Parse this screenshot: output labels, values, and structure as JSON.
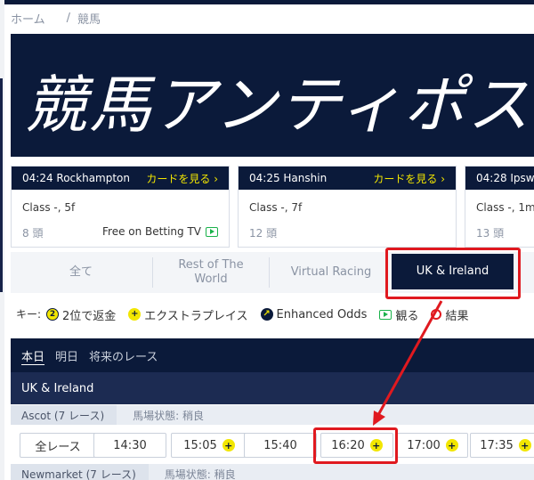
{
  "breadcrumb": {
    "home": "ホーム",
    "separator": "/",
    "current": "競馬"
  },
  "hero": {
    "title": "競馬アンティポスト"
  },
  "cards": [
    {
      "time_venue": "04:24 Rockhampton",
      "link": "カードを見る ›",
      "class": "Class -, 5f",
      "runners": "8 頭",
      "betting_tv": "Free on Betting TV"
    },
    {
      "time_venue": "04:25 Hanshin",
      "link": "カードを見る ›",
      "class": "Class -, 7f",
      "runners": "12 頭"
    },
    {
      "time_venue": "04:28 Ipsw",
      "class": "Class -, 1m",
      "runners": "13 頭"
    }
  ],
  "tabs": [
    {
      "label": "全て"
    },
    {
      "label": "Rest of The World"
    },
    {
      "label": "Virtual Racing"
    },
    {
      "label": "UK & Ireland"
    }
  ],
  "key": {
    "label": "キー:",
    "items": [
      {
        "icon": "2",
        "text": "2位で返金"
      },
      {
        "icon": "+",
        "text": "エクストラプレイス"
      },
      {
        "icon": "odds",
        "text": "Enhanced Odds"
      },
      {
        "icon": "tv",
        "text": "観る"
      },
      {
        "icon": "result",
        "text": "結果"
      }
    ]
  },
  "days": [
    "本日",
    "明日",
    "将来のレース"
  ],
  "region": "UK & Ireland",
  "meetings": [
    {
      "name": "Ascot (7 レース)",
      "going": "馬場状態: 稍良"
    },
    {
      "name": "Newmarket (7 レース)",
      "going": "馬場状態: 稍良"
    }
  ],
  "times": [
    {
      "label": "全レース"
    },
    {
      "label": "14:30"
    },
    {
      "label": "15:05"
    },
    {
      "label": "15:40"
    },
    {
      "label": "16:20"
    },
    {
      "label": "17:00"
    },
    {
      "label": "17:35"
    }
  ],
  "colors": {
    "navy": "#0b1a3a",
    "yellow": "#f2e600",
    "highlight": "#e0191f",
    "green": "#1bb24b"
  }
}
